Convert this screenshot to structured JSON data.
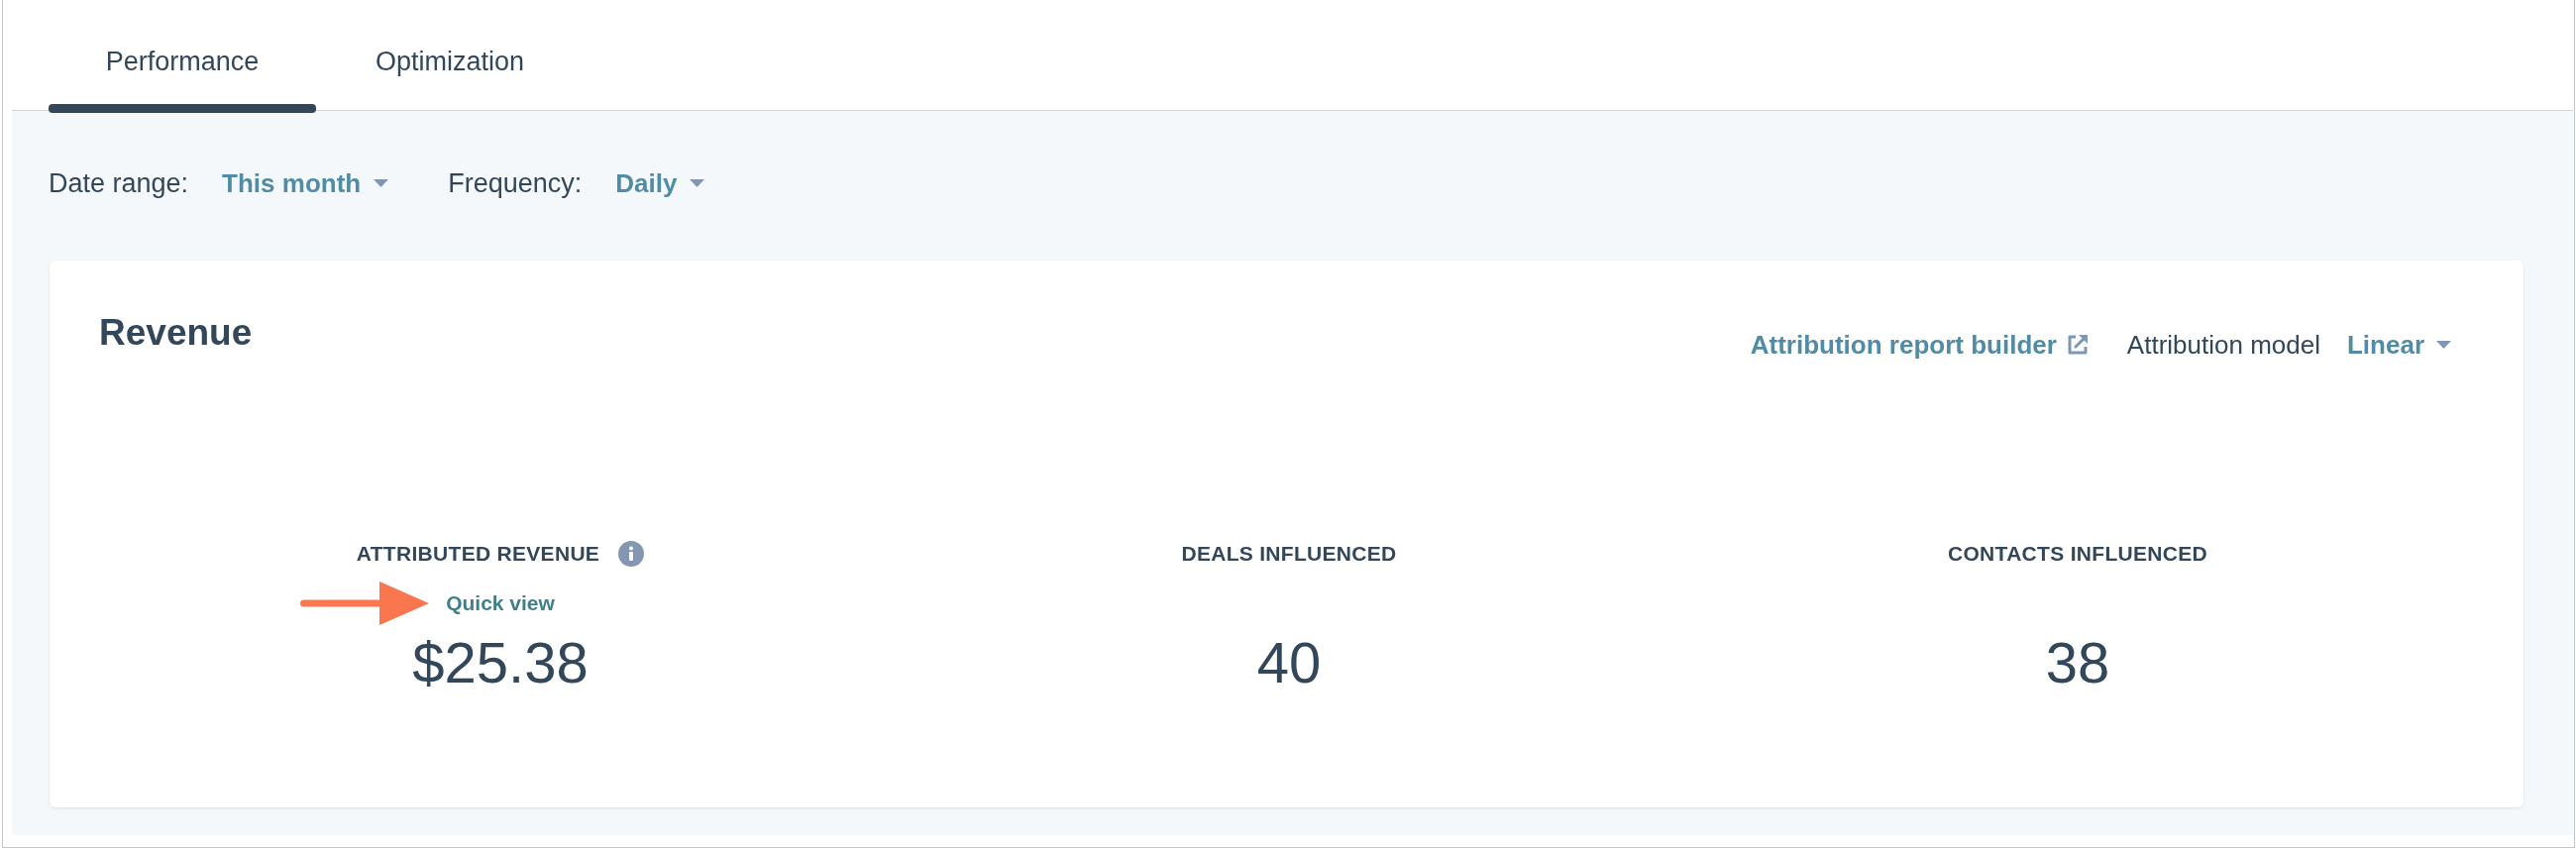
{
  "tabs": [
    {
      "label": "Performance",
      "selected": true
    },
    {
      "label": "Optimization",
      "selected": false
    }
  ],
  "filters": [
    {
      "label": "Date range:",
      "value": "This month"
    },
    {
      "label": "Frequency:",
      "value": "Daily"
    }
  ],
  "revenue_card": {
    "title": "Revenue",
    "report_link": "Attribution report builder",
    "model_label": "Attribution model",
    "model_value": "Linear",
    "stats": [
      {
        "label": "ATTRIBUTED REVENUE",
        "info": true,
        "link": "Quick view",
        "pointed_at": true,
        "value": "$25.38"
      },
      {
        "label": "DEALS INFLUENCED",
        "info": false,
        "pointed_at": false,
        "value": "40"
      },
      {
        "label": "CONTACTS INFLUENCED",
        "info": false,
        "pointed_at": false,
        "value": "38"
      }
    ]
  }
}
